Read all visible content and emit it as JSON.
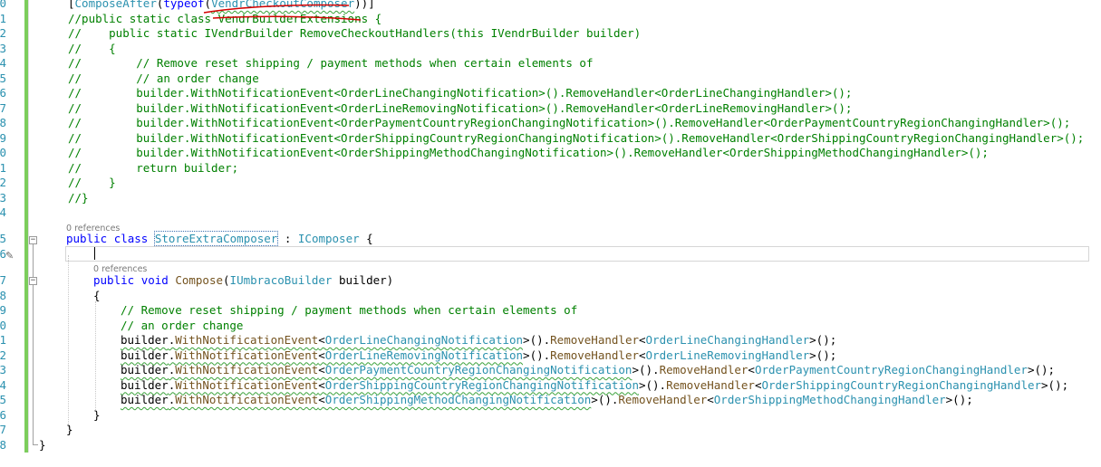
{
  "line_numbers": [
    "0",
    "1",
    "2",
    "3",
    "4",
    "5",
    "6",
    "7",
    "8",
    "9",
    "0",
    "1",
    "2",
    "3",
    "4",
    "5",
    "6",
    "7",
    "8",
    "9",
    "0",
    "1",
    "2",
    "3",
    "4",
    "5",
    "6",
    "7",
    "8"
  ],
  "codelens": {
    "class_refs": "0 references",
    "method_refs": "0 references"
  },
  "code": {
    "l0": {
      "open": "[",
      "attr": "ComposeAfter",
      "p1": "(",
      "kw": "typeof",
      "p2": "(",
      "type": "VendrCheckoutComposer",
      "close": "))]"
    },
    "l1": "//public static class VendrBuilderExtensions {",
    "l2": "//    public static IVendrBuilder RemoveCheckoutHandlers(this IVendrBuilder builder)",
    "l3": "//    {",
    "l4": "//        // Remove reset shipping / payment methods when certain elements of",
    "l5": "//        // an order change",
    "l6": "//        builder.WithNotificationEvent<OrderLineChangingNotification>().RemoveHandler<OrderLineChangingHandler>();",
    "l7": "//        builder.WithNotificationEvent<OrderLineRemovingNotification>().RemoveHandler<OrderLineRemovingHandler>();",
    "l8": "//        builder.WithNotificationEvent<OrderPaymentCountryRegionChangingNotification>().RemoveHandler<OrderPaymentCountryRegionChangingHandler>();",
    "l9": "//        builder.WithNotificationEvent<OrderShippingCountryRegionChangingNotification>().RemoveHandler<OrderShippingCountryRegionChangingHandler>();",
    "l10": "//        builder.WithNotificationEvent<OrderShippingMethodChangingNotification>().RemoveHandler<OrderShippingMethodChangingHandler>();",
    "l11": "//        return builder;",
    "l12": "//    }",
    "l13": "//}",
    "class_line": {
      "kw1": "public",
      "kw2": "class",
      "name": "StoreExtraComposer",
      "colon": " : ",
      "iface": "IComposer",
      "brace": " {"
    },
    "method_line": {
      "kw1": "public",
      "kw2": "void",
      "name": "Compose",
      "p1": "(",
      "ptype": "IUmbracoBuilder",
      "pname": " builder",
      "p2": ")"
    },
    "open_brace": "{",
    "comment1": "// Remove reset shipping / payment methods when certain elements of",
    "comment2": "// an order change",
    "calls": [
      {
        "obj": "builder",
        "dot1": ".",
        "m1": "WithNotificationEvent",
        "lt1": "<",
        "t1": "OrderLineChangingNotification",
        "gt1": ">().",
        "m2": "RemoveHandler",
        "lt2": "<",
        "t2": "OrderLineChangingHandler",
        "end": ">();"
      },
      {
        "obj": "builder",
        "dot1": ".",
        "m1": "WithNotificationEvent",
        "lt1": "<",
        "t1": "OrderLineRemovingNotification",
        "gt1": ">().",
        "m2": "RemoveHandler",
        "lt2": "<",
        "t2": "OrderLineRemovingHandler",
        "end": ">();"
      },
      {
        "obj": "builder",
        "dot1": ".",
        "m1": "WithNotificationEvent",
        "lt1": "<",
        "t1": "OrderPaymentCountryRegionChangingNotification",
        "gt1": ">().",
        "m2": "RemoveHandler",
        "lt2": "<",
        "t2": "OrderPaymentCountryRegionChangingHandler",
        "end": ">();"
      },
      {
        "obj": "builder",
        "dot1": ".",
        "m1": "WithNotificationEvent",
        "lt1": "<",
        "t1": "OrderShippingCountryRegionChangingNotification",
        "gt1": ">().",
        "m2": "RemoveHandler",
        "lt2": "<",
        "t2": "OrderShippingCountryRegionChangingHandler",
        "end": ">();"
      },
      {
        "obj": "builder",
        "dot1": ".",
        "m1": "WithNotificationEvent",
        "lt1": "<",
        "t1": "OrderShippingMethodChangingNotification",
        "gt1": ">().",
        "m2": "RemoveHandler",
        "lt2": "<",
        "t2": "OrderShippingMethodChangingHandler",
        "end": ">();"
      }
    ],
    "close_method": "}",
    "close_class": "}",
    "close_ns": "}"
  },
  "colors": {
    "keyword": "#0000ff",
    "type": "#2b91af",
    "comment": "#008000",
    "method": "#74531f",
    "change_bar": "#7ccd5c",
    "squiggle": "#3aa23a",
    "annotation": "#d40000"
  },
  "icons": {
    "fold": "fold-toggle-icon",
    "quick_action": "screwdriver-icon"
  }
}
